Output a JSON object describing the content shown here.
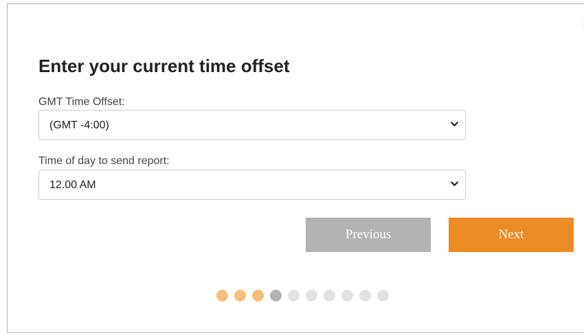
{
  "dialog": {
    "title": "Enter your current time offset",
    "close_glyph": "×"
  },
  "fields": [
    {
      "label": "GMT Time Offset:",
      "selected_value": "(GMT -4:00)"
    },
    {
      "label": "Time of day to send report:",
      "selected_value": "12.00 AM"
    }
  ],
  "buttons": {
    "previous_label": "Previous",
    "next_label": "Next"
  },
  "progress": {
    "total_steps": 10,
    "completed_steps": 3,
    "current_step": 4
  },
  "colors": {
    "accent": "#ec8c24",
    "disabled": "#b3b3b3",
    "dot_completed": "#f7c07a",
    "dot_current": "#b3b3b3",
    "dot_upcoming": "#e2e2e2"
  },
  "icons": {
    "close": "close-icon",
    "dropdown": "chevron-down-icon"
  }
}
